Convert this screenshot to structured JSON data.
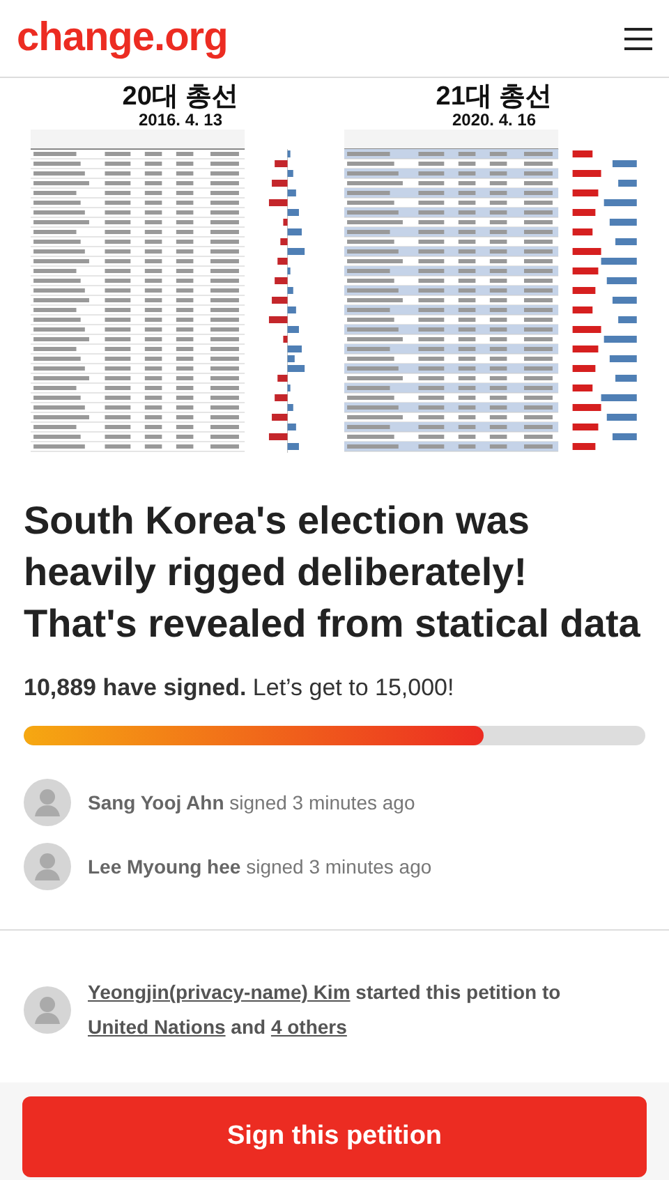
{
  "header": {
    "logo": "change.org"
  },
  "image_panels": [
    {
      "title": "20대 총선",
      "date": "2016. 4. 13",
      "kind": "mixed"
    },
    {
      "title": "21대 총선",
      "date": "2020. 4. 16",
      "kind": "alternating"
    }
  ],
  "headline": "South Korea's election was heavily rigged deliberately! That's revealed from statical data",
  "signatures": {
    "text": "**10,889 have signed.** Let’s get to 15,000!",
    "level": 0.74
  },
  "signers": [
    {
      "text": "**Sang Yooj Ahn** signed 3 minutes ago"
    },
    {
      "text": "**Lee Myoung hee** signed 3 minutes ago"
    }
  ],
  "starter": {
    "name": "Yeongjin(privacy-name) Kim",
    "action": " started this petition to ",
    "target": "United Nations",
    "connector": " and ",
    "others": "4 others"
  },
  "cta": "Sign this petition"
}
